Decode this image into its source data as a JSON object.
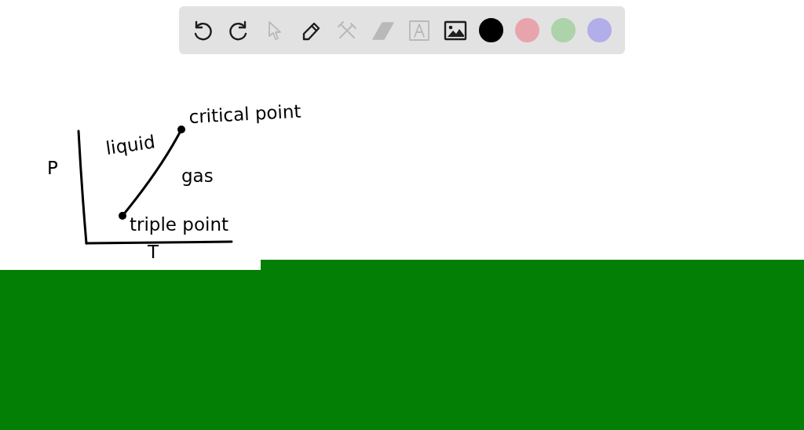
{
  "toolbar": {
    "tools": [
      {
        "kind": "undo",
        "disabled": false
      },
      {
        "kind": "redo",
        "disabled": false
      },
      {
        "kind": "select",
        "disabled": true
      },
      {
        "kind": "pen",
        "disabled": false
      },
      {
        "kind": "tools",
        "disabled": true
      },
      {
        "kind": "eraser",
        "disabled": true
      },
      {
        "kind": "text",
        "disabled": true
      },
      {
        "kind": "image",
        "disabled": false
      }
    ],
    "colors": [
      {
        "color": "#000000"
      },
      {
        "color": "#e8a4ad"
      },
      {
        "color": "#acd3a9"
      },
      {
        "color": "#b2aeea"
      }
    ]
  },
  "sketch": {
    "y_axis_label": "P",
    "x_axis_label": "T",
    "region_labels": [
      "liquid",
      "gas"
    ],
    "point_labels": [
      "critical point",
      "triple point"
    ]
  }
}
